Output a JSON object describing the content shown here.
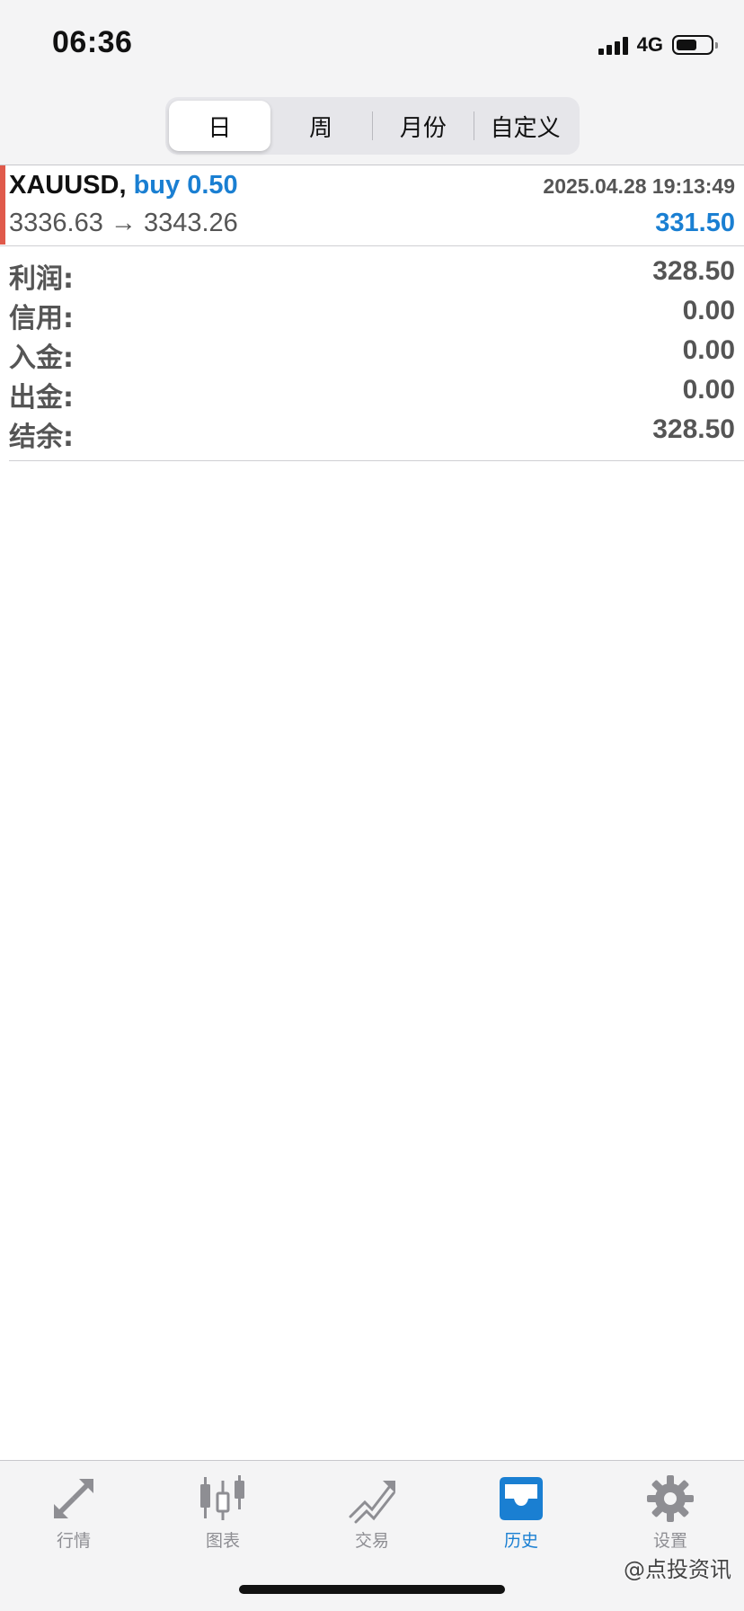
{
  "status_bar": {
    "time": "06:36",
    "network": "4G"
  },
  "period_tabs": [
    {
      "label": "日",
      "active": true
    },
    {
      "label": "周",
      "active": false
    },
    {
      "label": "月份",
      "active": false
    },
    {
      "label": "自定义",
      "active": false
    }
  ],
  "trade": {
    "symbol": "XAUUSD,",
    "type": "buy 0.50",
    "datetime": "2025.04.28 19:13:49",
    "open_price": "3336.63",
    "arrow": "→",
    "close_price": "3343.26",
    "profit": "331.50",
    "accent_color": "#e05a4b"
  },
  "summary": [
    {
      "label": "利润:",
      "value": "328.50"
    },
    {
      "label": "信用:",
      "value": "0.00"
    },
    {
      "label": "入金:",
      "value": "0.00"
    },
    {
      "label": "出金:",
      "value": "0.00"
    },
    {
      "label": "结余:",
      "value": "328.50"
    }
  ],
  "bottom_tabs": [
    {
      "label": "行情",
      "icon": "quotes-arrows-icon",
      "active": false
    },
    {
      "label": "图表",
      "icon": "candlestick-chart-icon",
      "active": false
    },
    {
      "label": "交易",
      "icon": "trade-trend-icon",
      "active": false
    },
    {
      "label": "历史",
      "icon": "history-inbox-icon",
      "active": true
    },
    {
      "label": "设置",
      "icon": "gear-icon",
      "active": false
    }
  ],
  "watermark": "@点投资讯",
  "colors": {
    "accent_blue": "#1a7fd2",
    "inactive_gray": "#8e8e93",
    "sell_red": "#e05a4b"
  }
}
